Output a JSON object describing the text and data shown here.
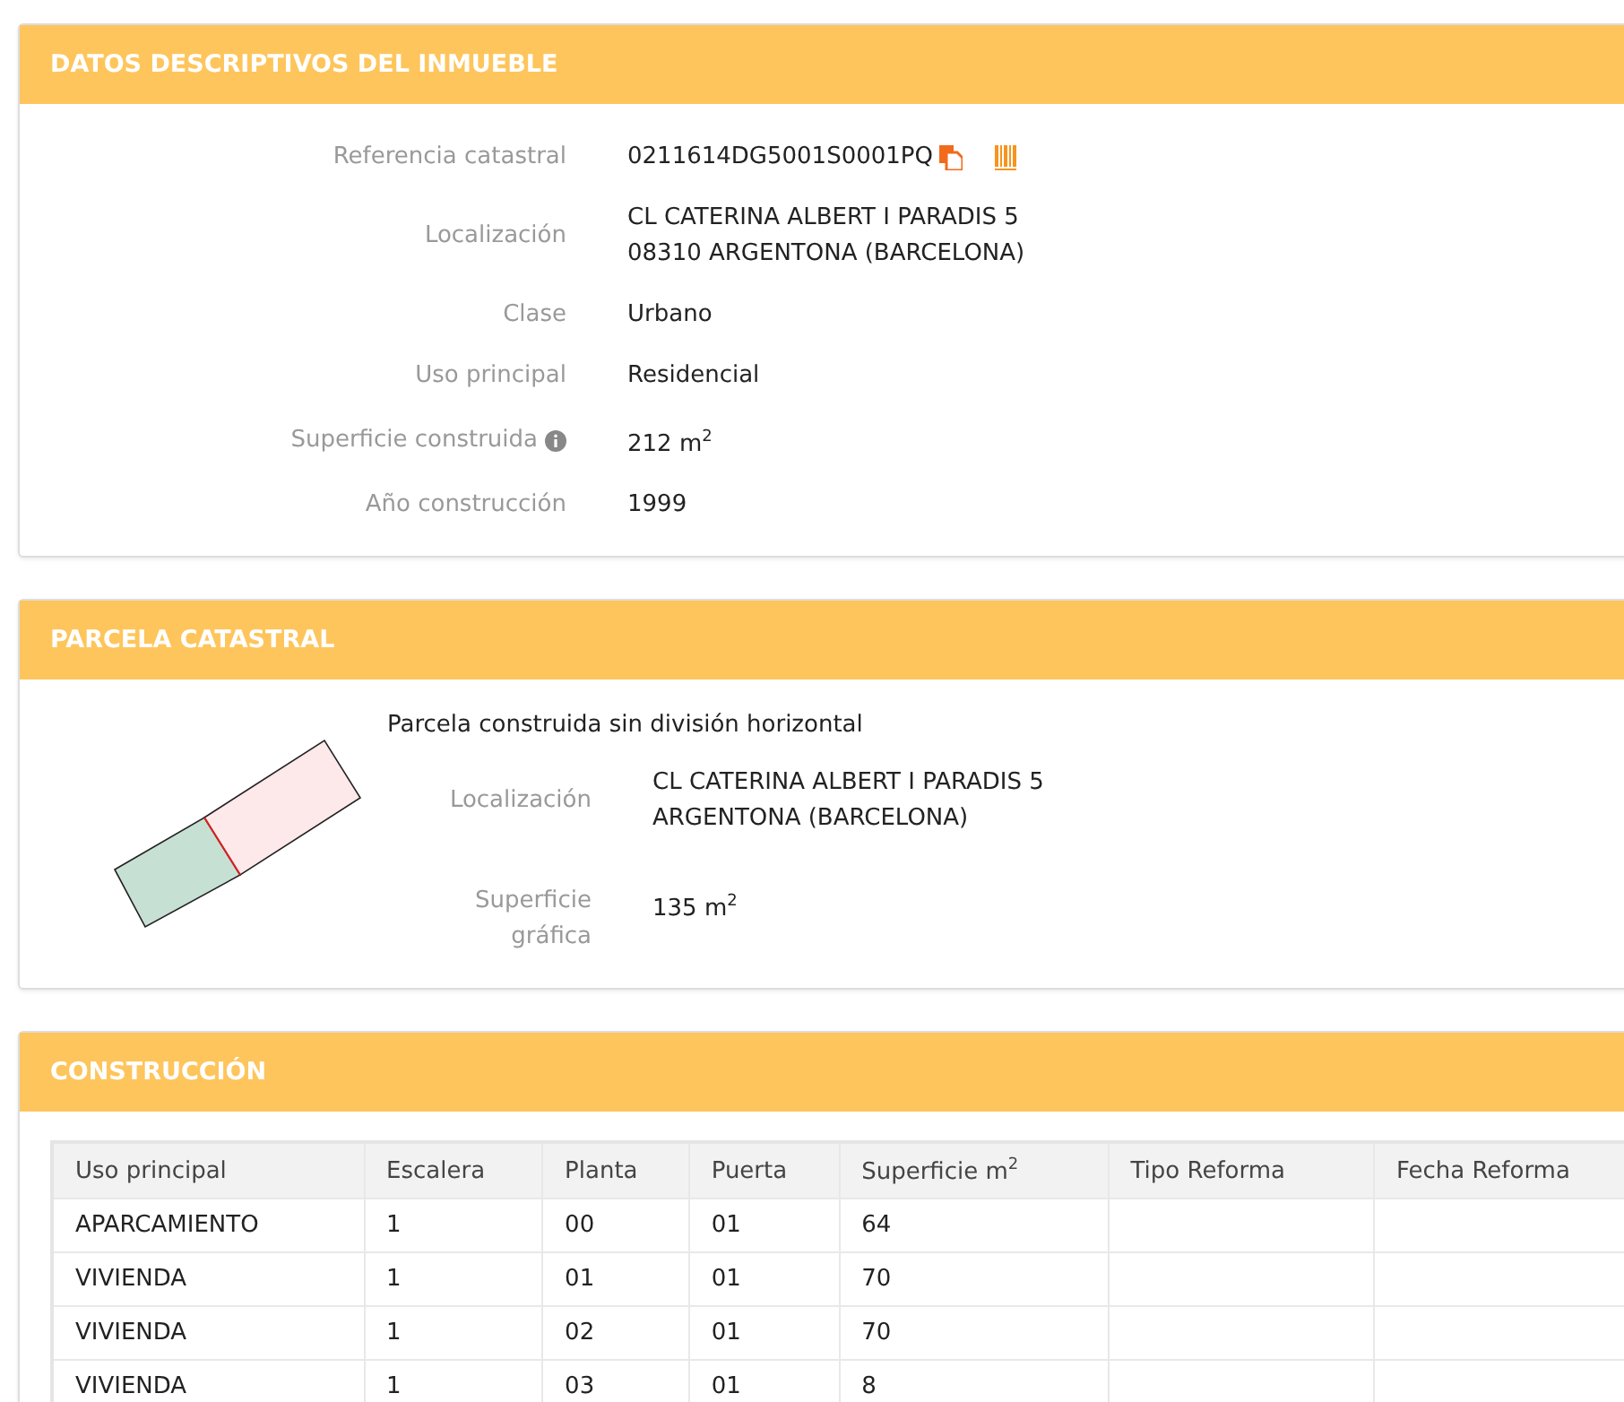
{
  "datos": {
    "title": "DATOS DESCRIPTIVOS DEL INMUEBLE",
    "fields": [
      {
        "label": "Referencia catastral",
        "lines": [
          "0211614DG5001S0001PQ"
        ],
        "kind": "reference"
      },
      {
        "label": "Localización",
        "lines": [
          "CL CATERINA ALBERT I PARADIS 5",
          "08310 ARGENTONA (BARCELONA)"
        ],
        "kind": "text"
      },
      {
        "label": "Clase",
        "lines": [
          "Urbano"
        ],
        "kind": "text"
      },
      {
        "label": "Uso principal",
        "lines": [
          "Residencial"
        ],
        "kind": "text"
      },
      {
        "label": "Superficie construida",
        "lines": [
          "212 m$^{2}$"
        ],
        "kind": "info"
      },
      {
        "label": "Año construcción",
        "lines": [
          "1999"
        ],
        "kind": "text"
      }
    ]
  },
  "parcela": {
    "title": "PARCELA CATASTRAL",
    "subtitle": "Parcela construida sin división horizontal",
    "fields": [
      {
        "label": "Localización",
        "lines": [
          "CL CATERINA ALBERT I PARADIS 5",
          "ARGENTONA (BARCELONA)"
        ]
      },
      {
        "label": "Superficie gráfica",
        "lines": [
          "135 m$^{2}$"
        ]
      }
    ]
  },
  "construccion": {
    "title": "CONSTRUCCIÓN",
    "columns": [
      "Uso principal",
      "Escalera",
      "Planta",
      "Puerta",
      "Superficie m$^{2}$",
      "Tipo Reforma",
      "Fecha Reforma"
    ],
    "rows": [
      [
        "APARCAMIENTO",
        "1",
        "00",
        "01",
        "64"
      ],
      [
        "VIVIENDA",
        "1",
        "01",
        "01",
        "70"
      ],
      [
        "VIVIENDA",
        "1",
        "02",
        "01",
        "70"
      ],
      [
        "VIVIENDA",
        "1",
        "03",
        "01",
        "8"
      ]
    ]
  }
}
